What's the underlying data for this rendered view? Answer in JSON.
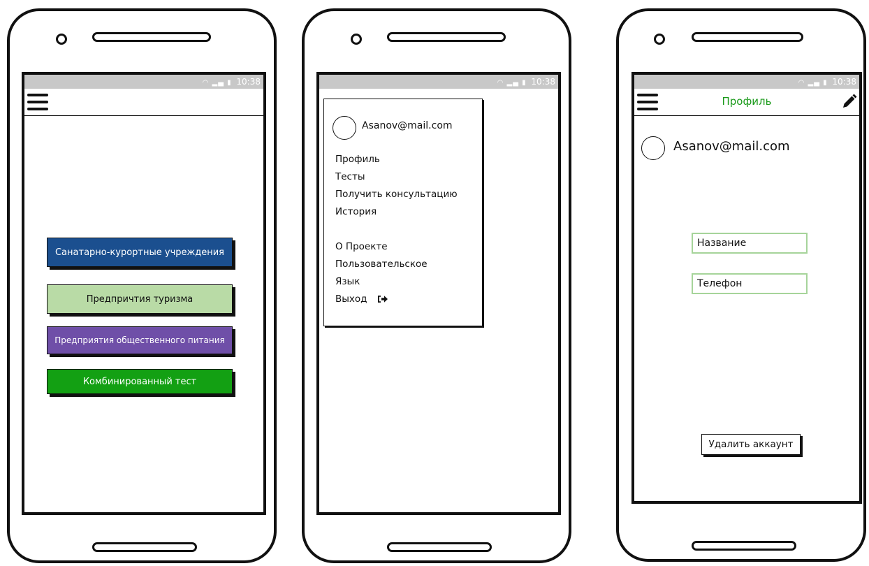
{
  "status_bar": {
    "time": "10:38",
    "icons": "wifi-signal-battery"
  },
  "screen1": {
    "buttons": [
      {
        "label": "Санатарно-курортные учреждения",
        "bg": "#1b4f8f",
        "color": "#ffffff"
      },
      {
        "label": "Предпричтия туризма",
        "bg": "#b9dba6",
        "color": "#111111"
      },
      {
        "label": "Предприятия общественного питания",
        "bg": "#6f4fa8",
        "color": "#ffffff"
      },
      {
        "label": "Комбинированный тест",
        "bg": "#13a013",
        "color": "#ffffff"
      }
    ]
  },
  "screen2": {
    "email": "Asanov@mail.com",
    "menu": {
      "profile": "Профиль",
      "tests": "Тесты",
      "consult": "Получить консультацию",
      "history": "История",
      "about": "О Проекте",
      "user": "Пользовательское",
      "language": "Язык",
      "exit": "Выход"
    }
  },
  "screen3": {
    "title": "Профиль",
    "email": "Asanov@mail.com",
    "name_placeholder": "Название",
    "phone_placeholder": "Телефон",
    "delete_label": "Удалить аккаунт",
    "accent": "#1a9a1a",
    "field_border": "#a6d49a"
  }
}
